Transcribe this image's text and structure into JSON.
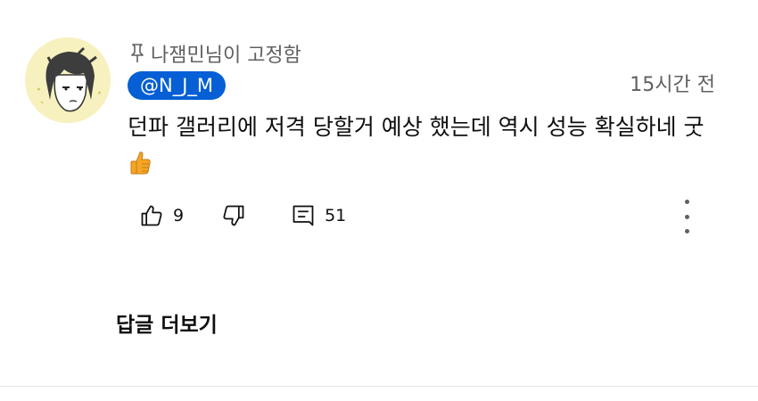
{
  "comment": {
    "pinned_label": "나잼민님이 고정함",
    "author_handle": "@N_J_M",
    "timestamp": "15시간 전",
    "text": "던파 갤러리에 저격 당할거 예상 했는데 역시 성능 확실하네 굿",
    "emoji_icon": "thumbs-up-emoji",
    "likes": "9",
    "replies": "51",
    "more_replies_label": "답글 더보기"
  },
  "colors": {
    "badge_background": "#065fd4",
    "secondary_text": "#606060",
    "avatar_background": "#f7f1bf"
  },
  "icons": [
    "pin-icon",
    "like-icon",
    "dislike-icon",
    "reply-icon",
    "more-vertical-icon"
  ]
}
